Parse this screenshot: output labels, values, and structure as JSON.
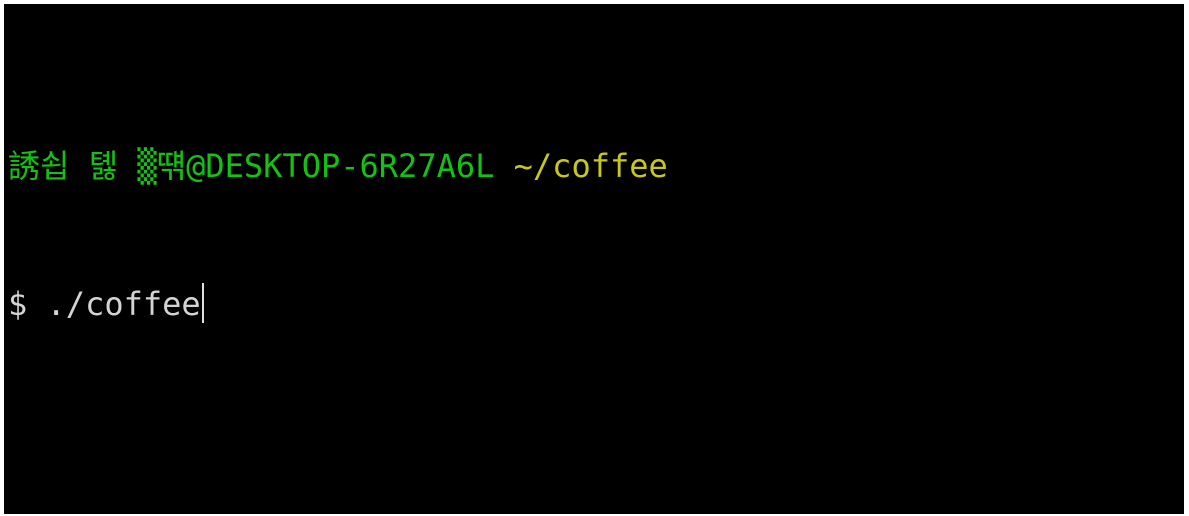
{
  "terminal": {
    "prompt": {
      "user": "誘쇱 톓 ▒떆",
      "at_host": "@DESKTOP-6R27A6L",
      "path": "~/coffee"
    },
    "input": {
      "sign": "$",
      "command": "./coffee"
    }
  },
  "colors": {
    "background": "#000000",
    "prompt_user_host": "#13c313",
    "prompt_path": "#c8c81a",
    "text": "#d4d4d4"
  }
}
